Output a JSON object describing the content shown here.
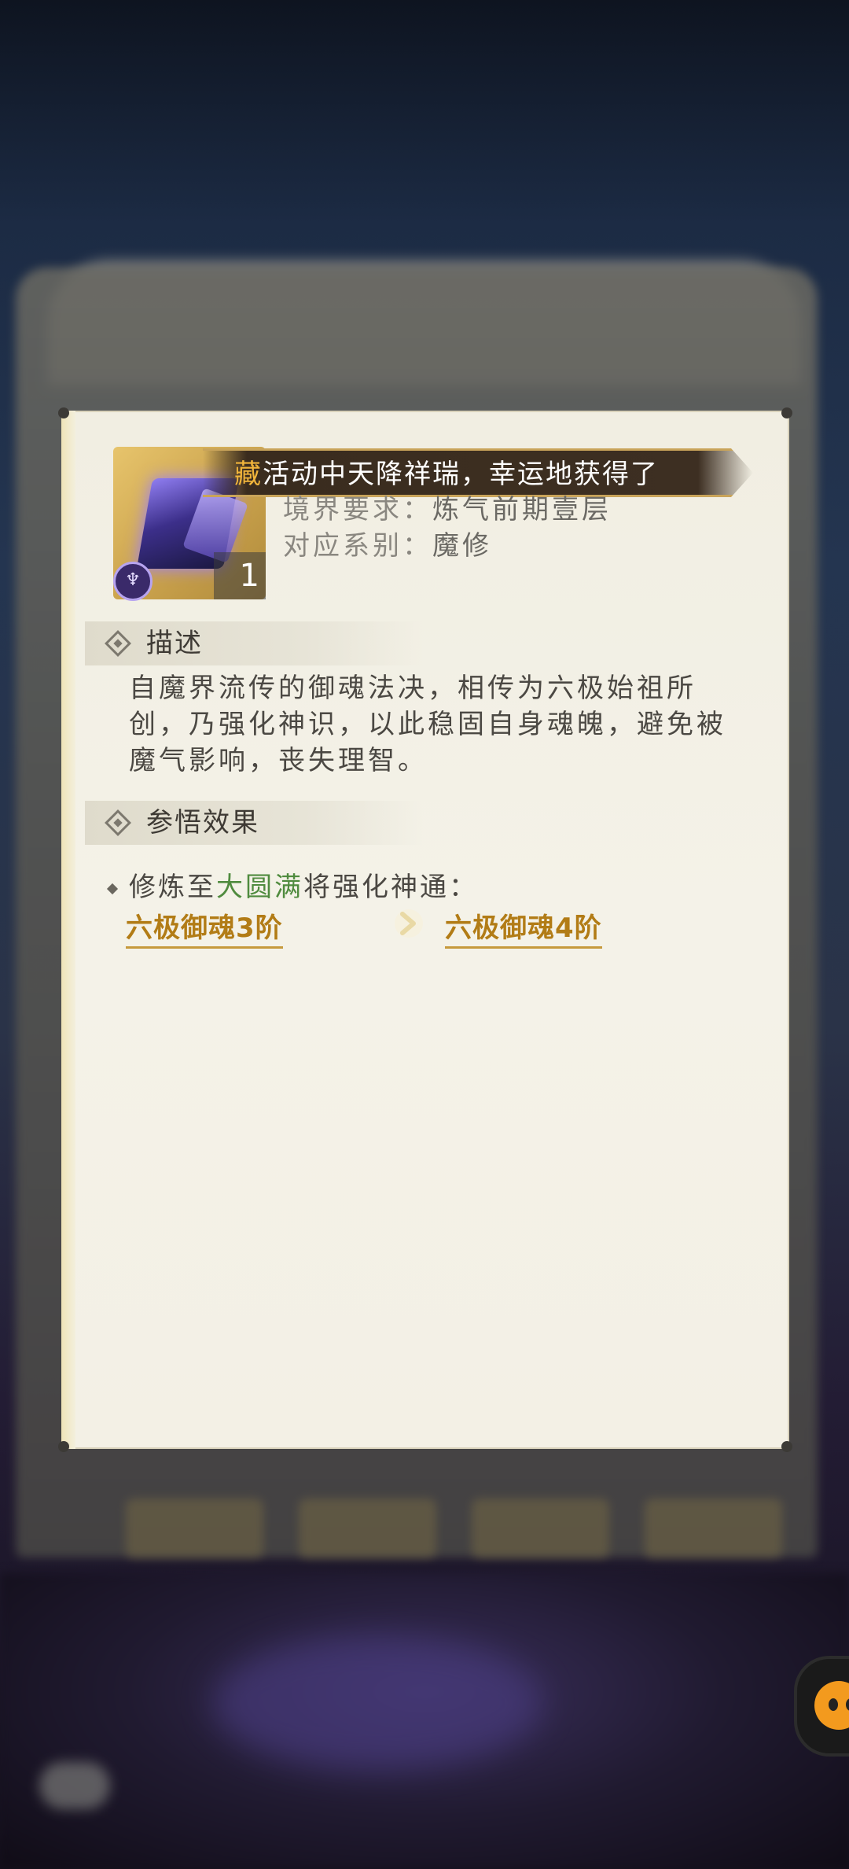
{
  "banner": {
    "highlight": "藏",
    "text": "活动中天降祥瑞，幸运地获得了"
  },
  "item": {
    "quantity": "1",
    "type_icon": "demon-sect-icon"
  },
  "attributes": [
    {
      "key": "境界要求：",
      "value": "炼气前期壹层"
    },
    {
      "key": "对应系别：",
      "value": "魔修"
    }
  ],
  "sections": {
    "description": {
      "title": "描述",
      "text": "自魔界流传的御魂法决，相传为六极始祖所创，乃强化神识，以此稳固自身魂魄，避免被魔气影响，丧失理智。"
    },
    "effect": {
      "title": "参悟效果",
      "line_prefix": "修炼至",
      "line_highlight": "大圆满",
      "line_suffix": "将强化神通：",
      "from_skill": "六极御魂3阶",
      "to_skill": "六极御魂4阶"
    }
  },
  "colors": {
    "highlight_gold": "#f1b53b",
    "link_gold": "#b27c16",
    "green": "#4f8b3e"
  }
}
